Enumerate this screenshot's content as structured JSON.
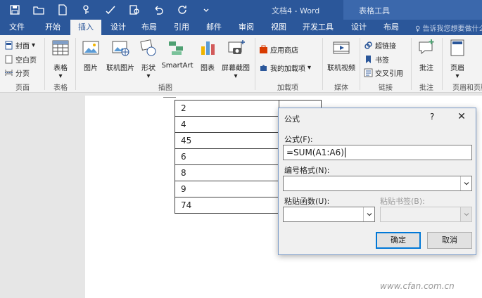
{
  "window": {
    "title": "文档4 - Word",
    "context_tab_group": "表格工具"
  },
  "tabs": [
    "文件",
    "开始",
    "插入",
    "设计",
    "布局",
    "引用",
    "邮件",
    "审阅",
    "视图",
    "开发工具",
    "设计",
    "布局"
  ],
  "active_tab": "插入",
  "tell_me": "告诉我您想要做什么",
  "ribbon": {
    "pages": {
      "cover": "封面",
      "blank": "空白页",
      "break": "分页",
      "label": "页面"
    },
    "tables": {
      "table": "表格",
      "label": "表格"
    },
    "illustrations": {
      "picture": "图片",
      "online_picture": "联机图片",
      "shapes": "形状",
      "smartart": "SmartArt",
      "chart": "图表",
      "screenshot": "屏幕截图",
      "label": "插图"
    },
    "addins": {
      "store": "应用商店",
      "my_addins": "我的加载项",
      "label": "加载项"
    },
    "media": {
      "online_video": "联机视频",
      "label": "媒体"
    },
    "links": {
      "hyperlink": "超链接",
      "bookmark": "书签",
      "crossref": "交叉引用",
      "label": "链接"
    },
    "comments": {
      "comment": "批注",
      "label": "批注"
    },
    "header_footer": {
      "header": "页眉",
      "label": "页眉和页脚"
    }
  },
  "table": {
    "values": [
      "2",
      "4",
      "45",
      "6",
      "8",
      "9",
      "74"
    ]
  },
  "dialog": {
    "title": "公式",
    "help": "?",
    "formula_label": "公式(F):",
    "formula_value": "=SUM(A1:A6)",
    "number_format_label": "编号格式(N):",
    "paste_function_label": "粘贴函数(U):",
    "paste_bookmark_label": "粘贴书签(B):",
    "ok": "确定",
    "cancel": "取消"
  },
  "watermark": "www.cfan.com.cn"
}
